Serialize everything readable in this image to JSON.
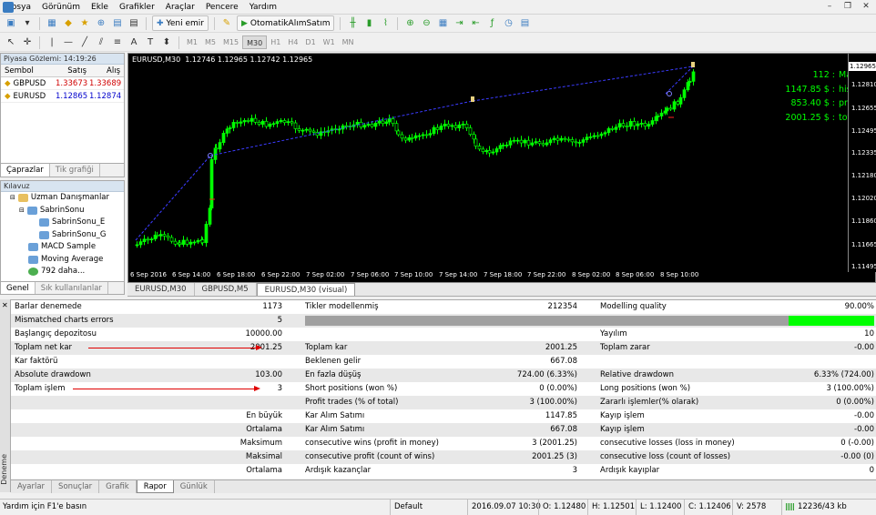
{
  "menu": [
    "Dosya",
    "Görünüm",
    "Ekle",
    "Grafikler",
    "Araçlar",
    "Pencere",
    "Yardım"
  ],
  "toolbar": {
    "new_order": "Yeni emir",
    "auto_trading": "OtomatikAlımSatım",
    "timeframes": [
      "M1",
      "M5",
      "M15",
      "M30",
      "H1",
      "H4",
      "D1",
      "W1",
      "MN"
    ],
    "active_tf": "M30"
  },
  "market_watch": {
    "title": "Piyasa Gözlemi: 14:19:26",
    "headers": [
      "Sembol",
      "Satış",
      "Alış"
    ],
    "rows": [
      {
        "symbol": "GBPUSD",
        "bid": "1.33673",
        "ask": "1.33689"
      },
      {
        "symbol": "EURUSD",
        "bid": "1.12865",
        "ask": "1.12874"
      }
    ],
    "tabs": [
      "Çaprazlar",
      "Tik grafiği"
    ]
  },
  "navigator": {
    "title": "Kılavuz",
    "items": [
      "Uzman Danışmanlar",
      "SabrinSonu",
      "SabrinSonu_E",
      "SabrinSonu_G",
      "MACD Sample",
      "Moving Average",
      "792 daha..."
    ],
    "tabs": [
      "Genel",
      "Sık kullanılanlar"
    ]
  },
  "chart": {
    "header": "EURUSD,M30  1.12746 1.12965 1.12742 1.12965",
    "yticks": [
      "1.12965",
      "1.12810",
      "1.12655",
      "1.12495",
      "1.12335",
      "1.12180",
      "1.12020",
      "1.11860",
      "1.11665",
      "1.11495"
    ],
    "xticks": [
      "6 Sep 2016",
      "6 Sep 14:00",
      "6 Sep 18:00",
      "6 Sep 22:00",
      "7 Sep 02:00",
      "7 Sep 06:00",
      "7 Sep 10:00",
      "7 Sep 14:00",
      "7 Sep 18:00",
      "7 Sep 22:00",
      "8 Sep 02:00",
      "8 Sep 06:00",
      "8 Sep 10:00"
    ],
    "info": [
      {
        "v": "112 :",
        "k": "Magic"
      },
      {
        "v": "1147.85 $ :",
        "k": "history"
      },
      {
        "v": "853.40 $ :",
        "k": "profit"
      },
      {
        "v": "2001.25 $ :",
        "k": "total"
      }
    ],
    "price_label": "1.12965",
    "colors": {
      "candle": "#00ff00",
      "trend": "#3b3bff",
      "text": "#00ff00"
    }
  },
  "chart_tabs": [
    "EURUSD,M30",
    "GBPUSD,M5",
    "EURUSD,M30 (visual)"
  ],
  "report": {
    "rows": [
      {
        "l1": "Barlar denemede",
        "v1": "1173",
        "l2": "Tikler modellenmiş",
        "v2": "212354",
        "l3": "Modelling quality",
        "v3": "90.00%"
      },
      {
        "l1": "Mismatched charts errors",
        "v1": "5",
        "l2": "",
        "v2": "",
        "l3": "",
        "v3": ""
      },
      {
        "l1": "Başlangıç depozitosu",
        "v1": "10000.00",
        "l2": "",
        "v2": "",
        "l3": "Yayılım",
        "v3": "10"
      },
      {
        "l1": "Toplam net kar",
        "v1": "2001.25",
        "l2": "Toplam kar",
        "v2": "2001.25",
        "l3": "Toplam zarar",
        "v3": "-0.00"
      },
      {
        "l1": "Kar faktörü",
        "v1": "",
        "l2": "Beklenen gelir",
        "v2": "667.08",
        "l3": "",
        "v3": ""
      },
      {
        "l1": "Absolute drawdown",
        "v1": "103.00",
        "l2": "En fazla düşüş",
        "v2": "724.00 (6.33%)",
        "l3": "Relative drawdown",
        "v3": "6.33% (724.00)"
      },
      {
        "l1": "Toplam işlem",
        "v1": "3",
        "l2": "Short positions (won %)",
        "v2": "0 (0.00%)",
        "l3": "Long positions (won %)",
        "v3": "3 (100.00%)"
      },
      {
        "l1": "",
        "v1": "",
        "l2": "Profit trades (% of total)",
        "v2": "3 (100.00%)",
        "l3": "Zararlı işlemler(% olarak)",
        "v3": "0 (0.00%)"
      },
      {
        "l1": "",
        "v1": "En büyük",
        "l2": "Kar Alım Satımı",
        "v2": "1147.85",
        "l3": "Kayıp işlem",
        "v3": "-0.00"
      },
      {
        "l1": "",
        "v1": "Ortalama",
        "l2": "Kar Alım Satımı",
        "v2": "667.08",
        "l3": "Kayıp işlem",
        "v3": "-0.00"
      },
      {
        "l1": "",
        "v1": "Maksimum",
        "l2": "consecutive wins (profit in money)",
        "v2": "3 (2001.25)",
        "l3": "consecutive losses (loss in money)",
        "v3": "0 (-0.00)"
      },
      {
        "l1": "",
        "v1": "Maksimal",
        "l2": "consecutive profit (count of wins)",
        "v2": "2001.25 (3)",
        "l3": "consecutive loss (count of losses)",
        "v3": "-0.00 (0)"
      },
      {
        "l1": "",
        "v1": "Ortalama",
        "l2": "Ardışık kazançlar",
        "v2": "3",
        "l3": "Ardışık kayıplar",
        "v3": "0"
      }
    ],
    "quality_colors": {
      "bar": "#a0a0a0",
      "good": "#00ff00"
    }
  },
  "side_label": "Deneme",
  "bottom_tabs": [
    "Ayarlar",
    "Sonuçlar",
    "Grafik",
    "Rapor",
    "Günlük"
  ],
  "active_bottom_tab": "Rapor",
  "status": {
    "help": "Yardım için F1'e basın",
    "profile": "Default",
    "time": "2016.09.07 10:30",
    "open": "O: 1.12480",
    "high": "H: 1.12501",
    "low": "L: 1.12400",
    "close": "C: 1.12406",
    "volume": "V: 2578",
    "traffic": "12236/43 kb"
  }
}
